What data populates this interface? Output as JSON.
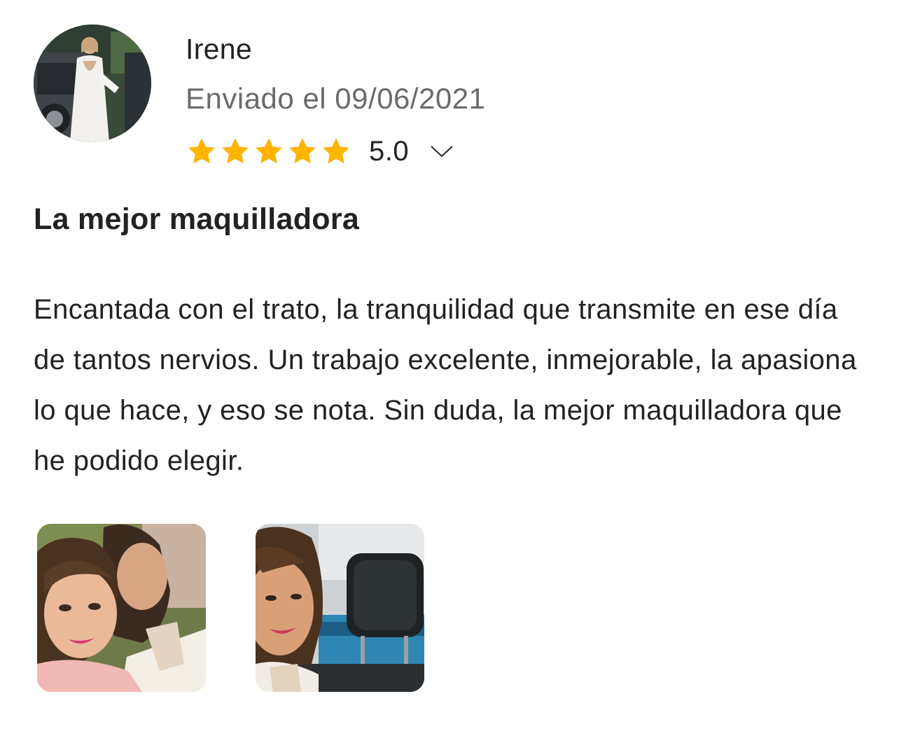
{
  "review": {
    "author": "Irene",
    "date": "Enviado el 09/06/2021",
    "rating": 5.0,
    "rating_label": "5.0",
    "stars_filled": 5,
    "stars_total": 5,
    "title": "La mejor maquilladora",
    "body": "Encantada con el trato, la tranquilidad que transmite en ese día de tantos nervios. Un trabajo excelente, inmejorable, la apasiona lo que hace, y eso se nota. Sin duda, la mejor maquilladora que he podido elegir."
  },
  "colors": {
    "star": "#FFB400",
    "text": "#222222",
    "muted": "#6b6b6b"
  },
  "icons": {
    "star": "star-icon",
    "expand": "chevron-down-icon"
  }
}
